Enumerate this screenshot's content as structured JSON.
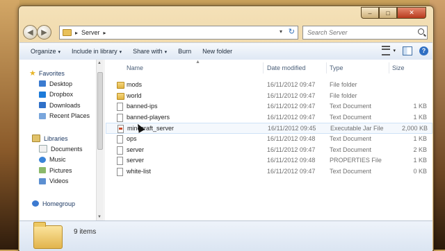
{
  "window": {
    "caption_buttons": {
      "minimize": "–",
      "maximize": "□",
      "close": "✕"
    }
  },
  "address": {
    "back_icon": "back-arrow-icon",
    "forward_icon": "forward-arrow-icon",
    "path": "Server",
    "separator": "▸",
    "dropdown": "▾",
    "refresh_glyph": "↻"
  },
  "search": {
    "placeholder": "Search Server"
  },
  "toolbar": {
    "organize": "Organize",
    "include_in_library": "Include in library",
    "share_with": "Share with",
    "burn": "Burn",
    "new_folder": "New folder",
    "arrow": "▾",
    "help": "?"
  },
  "nav": {
    "favorites": {
      "label": "Favorites",
      "items": [
        "Desktop",
        "Dropbox",
        "Downloads",
        "Recent Places"
      ]
    },
    "libraries": {
      "label": "Libraries",
      "items": [
        "Documents",
        "Music",
        "Pictures",
        "Videos"
      ]
    },
    "homegroup": {
      "label": "Homegroup"
    }
  },
  "columns": {
    "name": "Name",
    "date_modified": "Date modified",
    "type": "Type",
    "size": "Size"
  },
  "files": [
    {
      "name": "mods",
      "date": "16/11/2012 09:47",
      "type": "File folder",
      "size": "",
      "icon": "folder"
    },
    {
      "name": "world",
      "date": "16/11/2012 09:47",
      "type": "File folder",
      "size": "",
      "icon": "folder"
    },
    {
      "name": "banned-ips",
      "date": "16/11/2012 09:47",
      "type": "Text Document",
      "size": "1 KB",
      "icon": "text-document"
    },
    {
      "name": "banned-players",
      "date": "16/11/2012 09:47",
      "type": "Text Document",
      "size": "1 KB",
      "icon": "text-document"
    },
    {
      "name": "minecraft_server",
      "date": "16/11/2012 09:45",
      "type": "Executable Jar File",
      "size": "2,000 KB",
      "icon": "jar-file"
    },
    {
      "name": "ops",
      "date": "16/11/2012 09:48",
      "type": "Text Document",
      "size": "1 KB",
      "icon": "text-document"
    },
    {
      "name": "server",
      "date": "16/11/2012 09:47",
      "type": "Text Document",
      "size": "2 KB",
      "icon": "text-document"
    },
    {
      "name": "server",
      "date": "16/11/2012 09:48",
      "type": "PROPERTIES File",
      "size": "1 KB",
      "icon": "properties-file"
    },
    {
      "name": "white-list",
      "date": "16/11/2012 09:47",
      "type": "Text Document",
      "size": "0 KB",
      "icon": "text-document"
    }
  ],
  "status": {
    "item_count": "9 items"
  }
}
